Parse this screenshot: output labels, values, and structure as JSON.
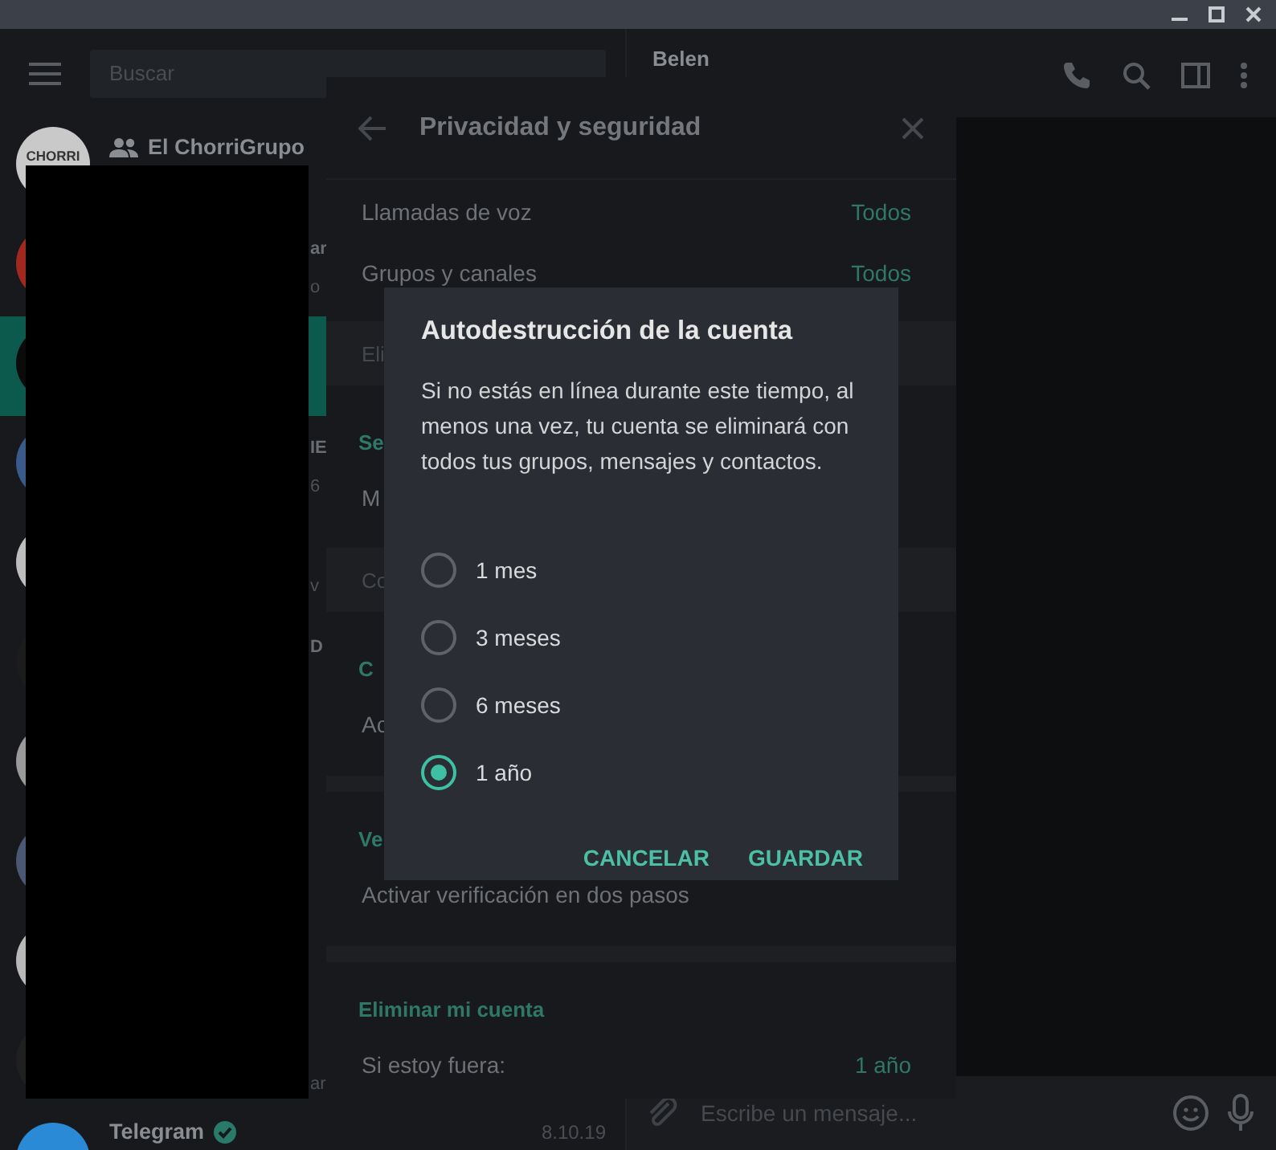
{
  "sidebar": {
    "search": {
      "placeholder": "Buscar"
    },
    "chats": [
      {
        "kind": "group",
        "name": "El ChorriGrupo",
        "avatar_text": "CHORRI",
        "selected": false,
        "color": "#c9c9c9"
      },
      {
        "name_fragment": "ar",
        "preview_fragment": "o",
        "selected": false,
        "color": "#a0281f"
      },
      {
        "selected": true,
        "color": "#0b0b0b"
      },
      {
        "name_fragment": "IE",
        "preview_fragment": "6",
        "selected": false,
        "color": "#3a5a8a"
      },
      {
        "preview_fragment": "v",
        "selected": false,
        "color": "#bdbdbd"
      },
      {
        "name_fragment": "D",
        "selected": false,
        "color": "#1c1c1c"
      },
      {
        "selected": false,
        "color": "#9a9a9a"
      },
      {
        "selected": false,
        "color": "#4b5874"
      },
      {
        "selected": false,
        "color": "#b8b8b8"
      },
      {
        "preview_fragment": "ar",
        "selected": false,
        "color": "#202020"
      },
      {
        "kind": "verified",
        "name": "Telegram",
        "date": "8.10.19",
        "selected": false,
        "color": "#2b8ad6"
      }
    ]
  },
  "chat": {
    "title": "Belen",
    "composer": {
      "placeholder": "Escribe un mensaje..."
    }
  },
  "settings_panel": {
    "title": "Privacidad y seguridad",
    "rows": [
      {
        "kind": "option",
        "label": "Llamadas de voz",
        "value": "Todos"
      },
      {
        "kind": "option",
        "label": "Grupos y canales",
        "value": "Todos"
      },
      {
        "kind": "note",
        "label": "Eli"
      },
      {
        "kind": "header",
        "label": "Se"
      },
      {
        "kind": "option",
        "label": "M"
      },
      {
        "kind": "note",
        "label": "Co"
      },
      {
        "kind": "header",
        "label": "C"
      },
      {
        "kind": "option",
        "label": "Ac"
      },
      {
        "kind": "gap"
      },
      {
        "kind": "header",
        "label": "Ve"
      },
      {
        "kind": "option",
        "label": "Activar verificación en dos pasos"
      },
      {
        "kind": "gap"
      },
      {
        "kind": "header",
        "label": "Eliminar mi cuenta"
      },
      {
        "kind": "option",
        "label": "Si estoy fuera:",
        "value": "1 año"
      }
    ]
  },
  "dialog": {
    "title": "Autodestrucción de la cuenta",
    "text": "Si no estás en línea durante este tiempo, al menos una vez, tu cuenta se eliminará con todos tus grupos, mensajes y contactos.",
    "options": [
      {
        "label": "1 mes",
        "selected": false
      },
      {
        "label": "3 meses",
        "selected": false
      },
      {
        "label": "6 meses",
        "selected": false
      },
      {
        "label": "1 año",
        "selected": true
      }
    ],
    "buttons": [
      "CANCELAR",
      "GUARDAR"
    ]
  }
}
